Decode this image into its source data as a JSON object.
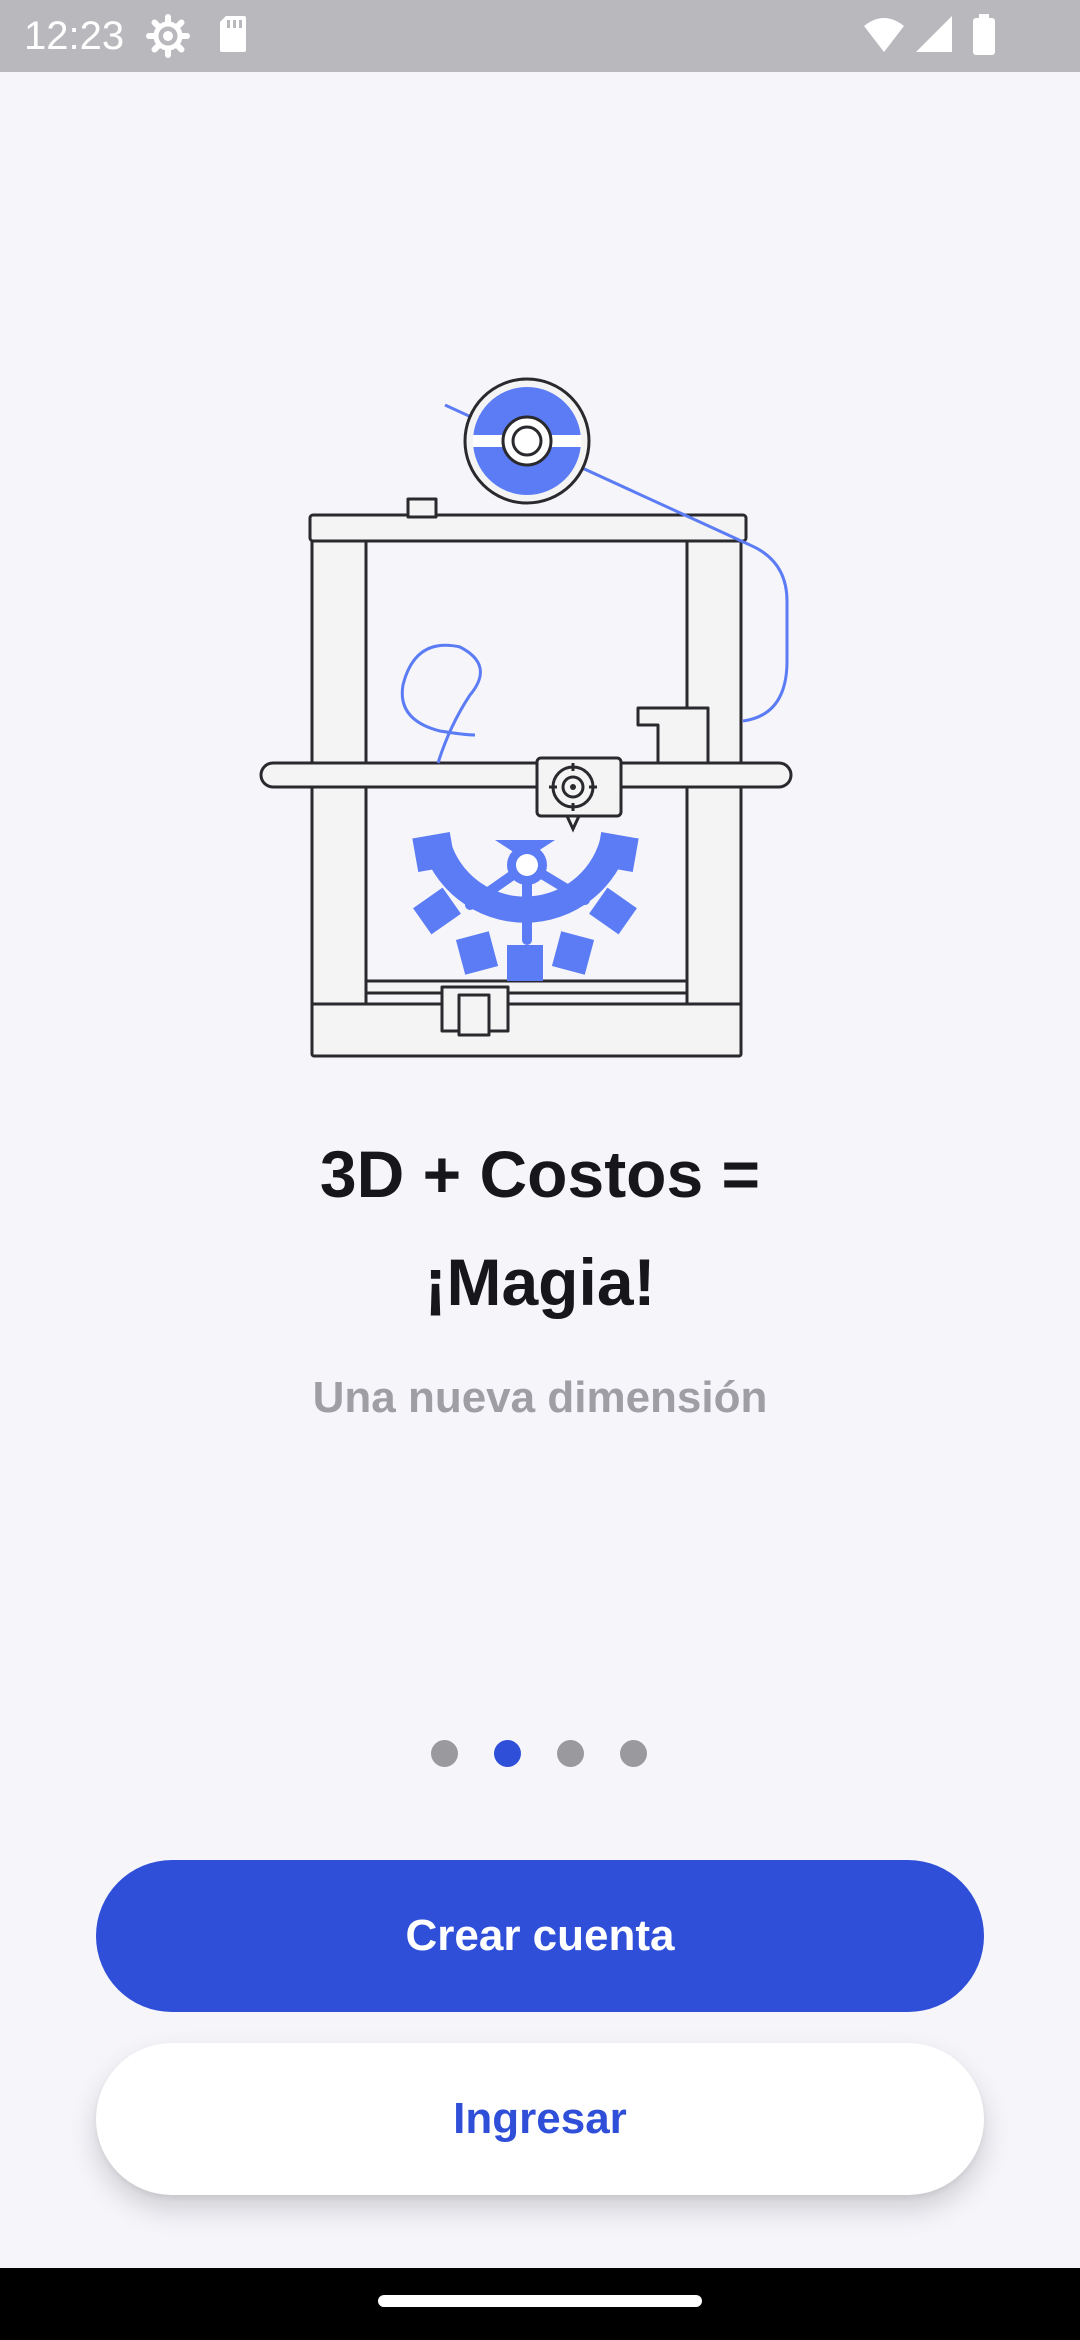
{
  "status_bar": {
    "time": "12:23",
    "left_icons": [
      "settings-gear-icon",
      "sd-card-icon"
    ],
    "right_icons": [
      "wifi-icon",
      "cell-signal-icon",
      "battery-icon"
    ]
  },
  "illustration": {
    "icon": "3d-printer-with-gear-icon",
    "colors": {
      "accent": "#5b7cf5",
      "outline": "#2a2a2e",
      "fill": "#f4f4f4"
    }
  },
  "onboarding": {
    "title_line1": "3D + Costos =",
    "title_line2": "¡Magia!",
    "subtitle": "Una nueva dimensión"
  },
  "pager": {
    "total": 4,
    "active_index": 1
  },
  "actions": {
    "create_account_label": "Crear cuenta",
    "login_label": "Ingresar"
  },
  "colors": {
    "primary": "#2f4fd8",
    "background": "#f6f5fa",
    "title_text": "#17171b",
    "subtitle_text": "#9e9ea4",
    "dot_inactive": "#9a9a9e"
  }
}
